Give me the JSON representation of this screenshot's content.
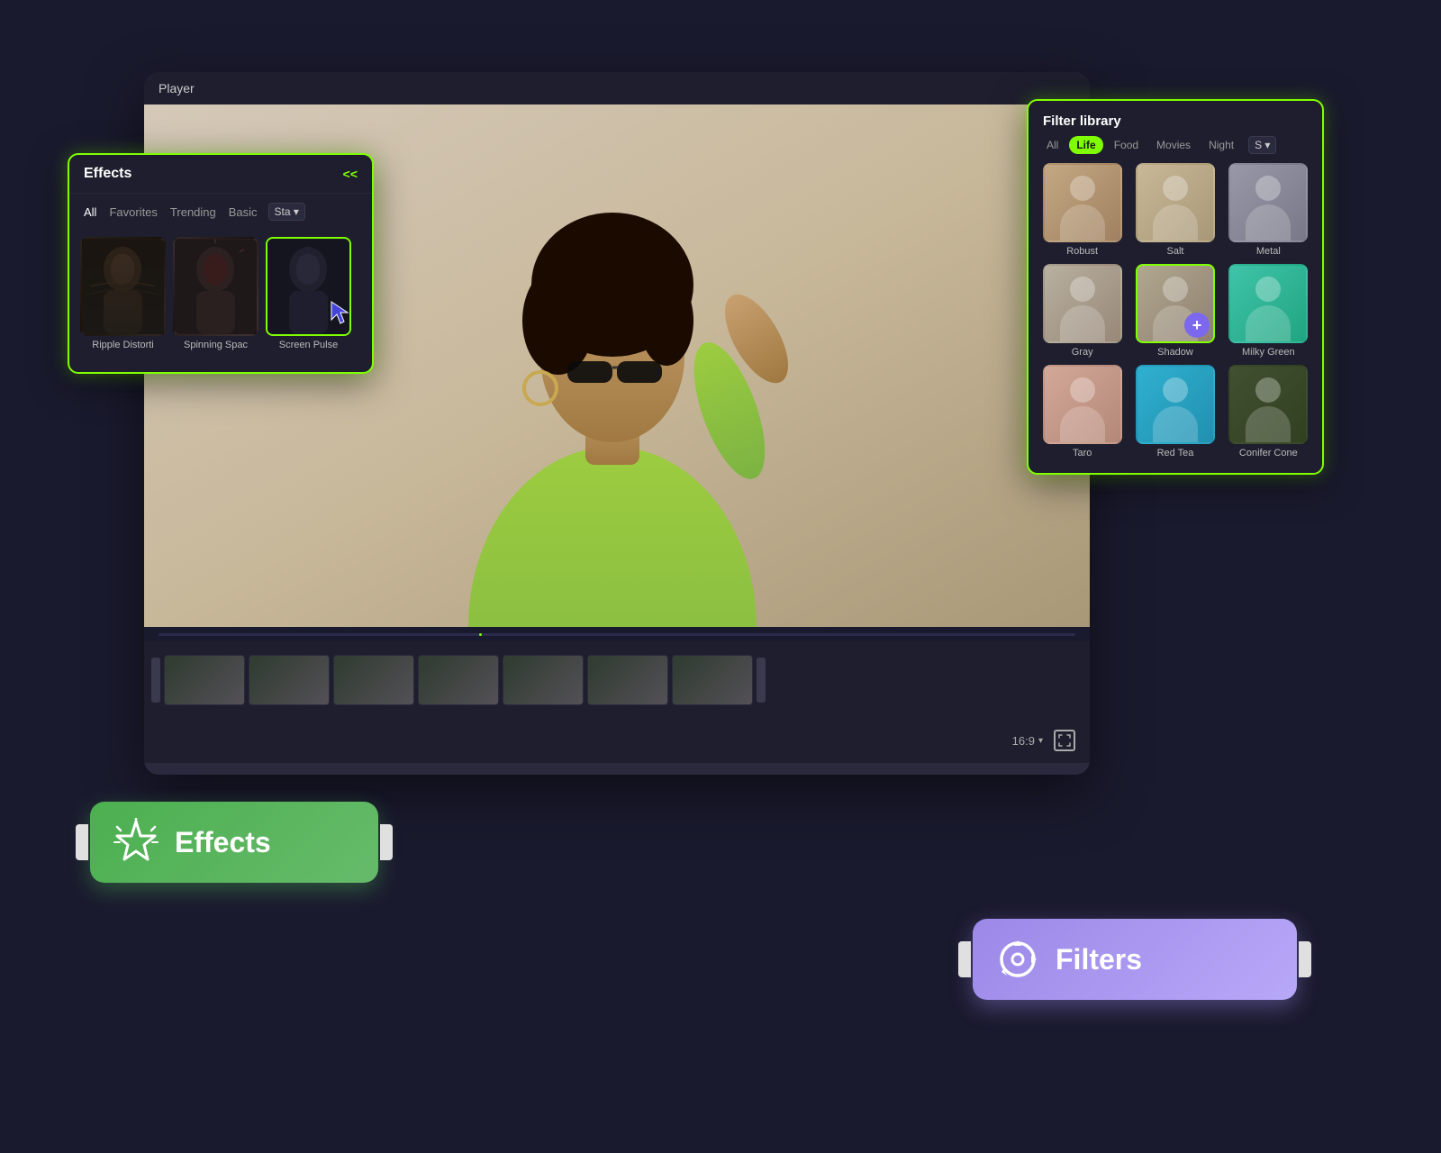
{
  "player": {
    "title": "Player"
  },
  "effects_panel": {
    "title": "Effects",
    "collapse_label": "<<",
    "tabs": [
      "All",
      "Favorites",
      "Trending",
      "Basic",
      "Sta..."
    ],
    "items": [
      {
        "label": "Ripple Distorti",
        "type": "dark-moody"
      },
      {
        "label": "Spinning Spac",
        "type": "dark-spin"
      },
      {
        "label": "Screen Pulse",
        "type": "dark-pulse",
        "selected": true
      }
    ]
  },
  "filter_library": {
    "title": "Filter library",
    "tabs": [
      "All",
      "Life",
      "Food",
      "Movies",
      "Night",
      "S..."
    ],
    "active_tab": "Life",
    "filters_row1": [
      {
        "label": "Robust",
        "style": "robust"
      },
      {
        "label": "Salt",
        "style": "salt"
      },
      {
        "label": "Metal",
        "style": "metal"
      }
    ],
    "filters_row2": [
      {
        "label": "Gray",
        "style": "gray"
      },
      {
        "label": "Shadow",
        "style": "shadow",
        "selected": true,
        "add_btn": true
      },
      {
        "label": "Milky Green",
        "style": "milky"
      }
    ],
    "filters_row3": [
      {
        "label": "Taro",
        "style": "taro"
      },
      {
        "label": "Red Tea",
        "style": "red-tea"
      },
      {
        "label": "Conifer Cone",
        "style": "conifer"
      }
    ]
  },
  "effects_badge": {
    "icon": "★",
    "text": "Effects"
  },
  "filters_badge": {
    "icon": "⟳",
    "text": "Filters"
  },
  "timeline": {
    "aspect_ratio": "16:9"
  }
}
